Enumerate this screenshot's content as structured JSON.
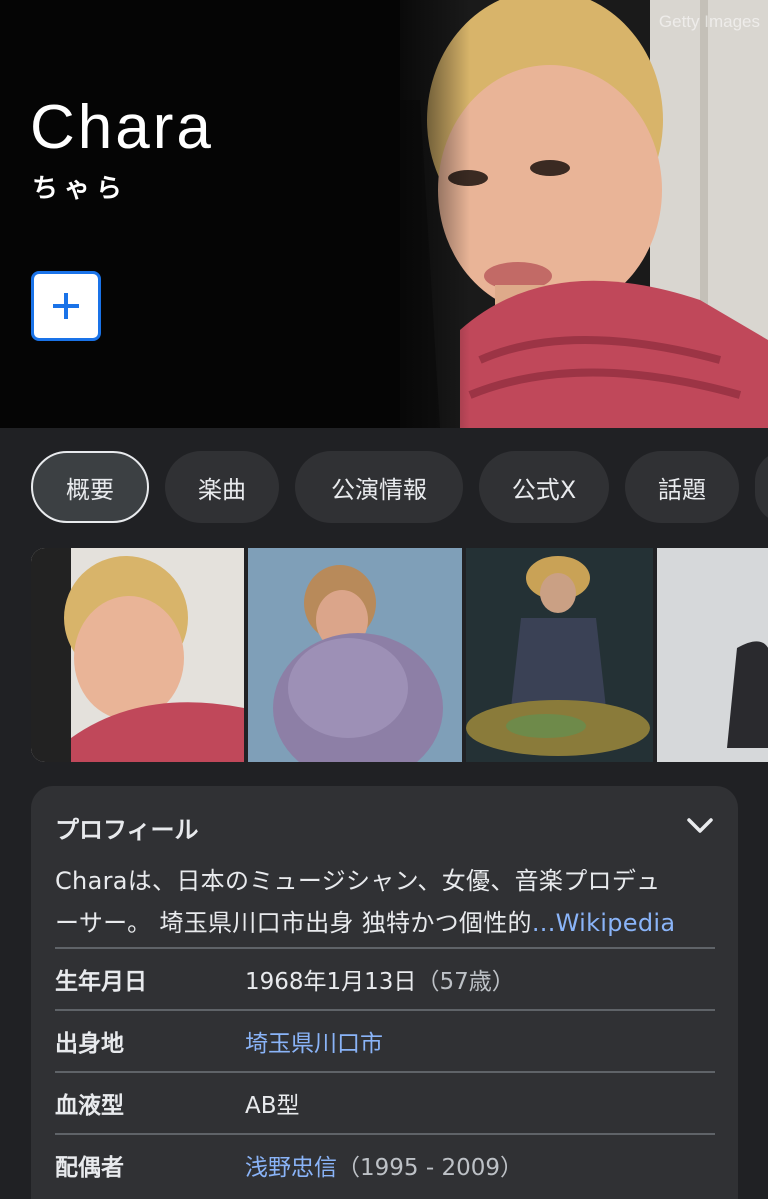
{
  "hero": {
    "title": "Chara",
    "subtitle": "ちゃら",
    "watermark": "Getty Images",
    "add_button_icon": "plus-icon",
    "accent_color": "#1a73e8"
  },
  "chips": [
    {
      "label": "概要",
      "selected": true
    },
    {
      "label": "楽曲"
    },
    {
      "label": "公演情報"
    },
    {
      "label": "公式X"
    },
    {
      "label": "話題"
    }
  ],
  "profile": {
    "title": "プロフィール",
    "collapse_icon": "chevron-down-icon",
    "description_line1": "Charaは、日本のミュージシャン、女優、音楽プロデュ",
    "description_line2": "ーサー。 埼玉県川口市出身 独特かつ個性的",
    "description_more": "...Wikipedia",
    "rows": [
      {
        "label": "生年月日",
        "value": "1968年1月13日",
        "extra": "（57歳）"
      },
      {
        "label": "出身地",
        "value": "埼玉県川口市",
        "extra": ""
      },
      {
        "label": "血液型",
        "value": "AB型",
        "extra": ""
      },
      {
        "label": "配偶者",
        "value": "浅野忠信",
        "extra": "（1995 - 2009）"
      }
    ]
  },
  "colors": {
    "background": "#202124",
    "card": "#303134",
    "link": "#8ab4f8"
  }
}
